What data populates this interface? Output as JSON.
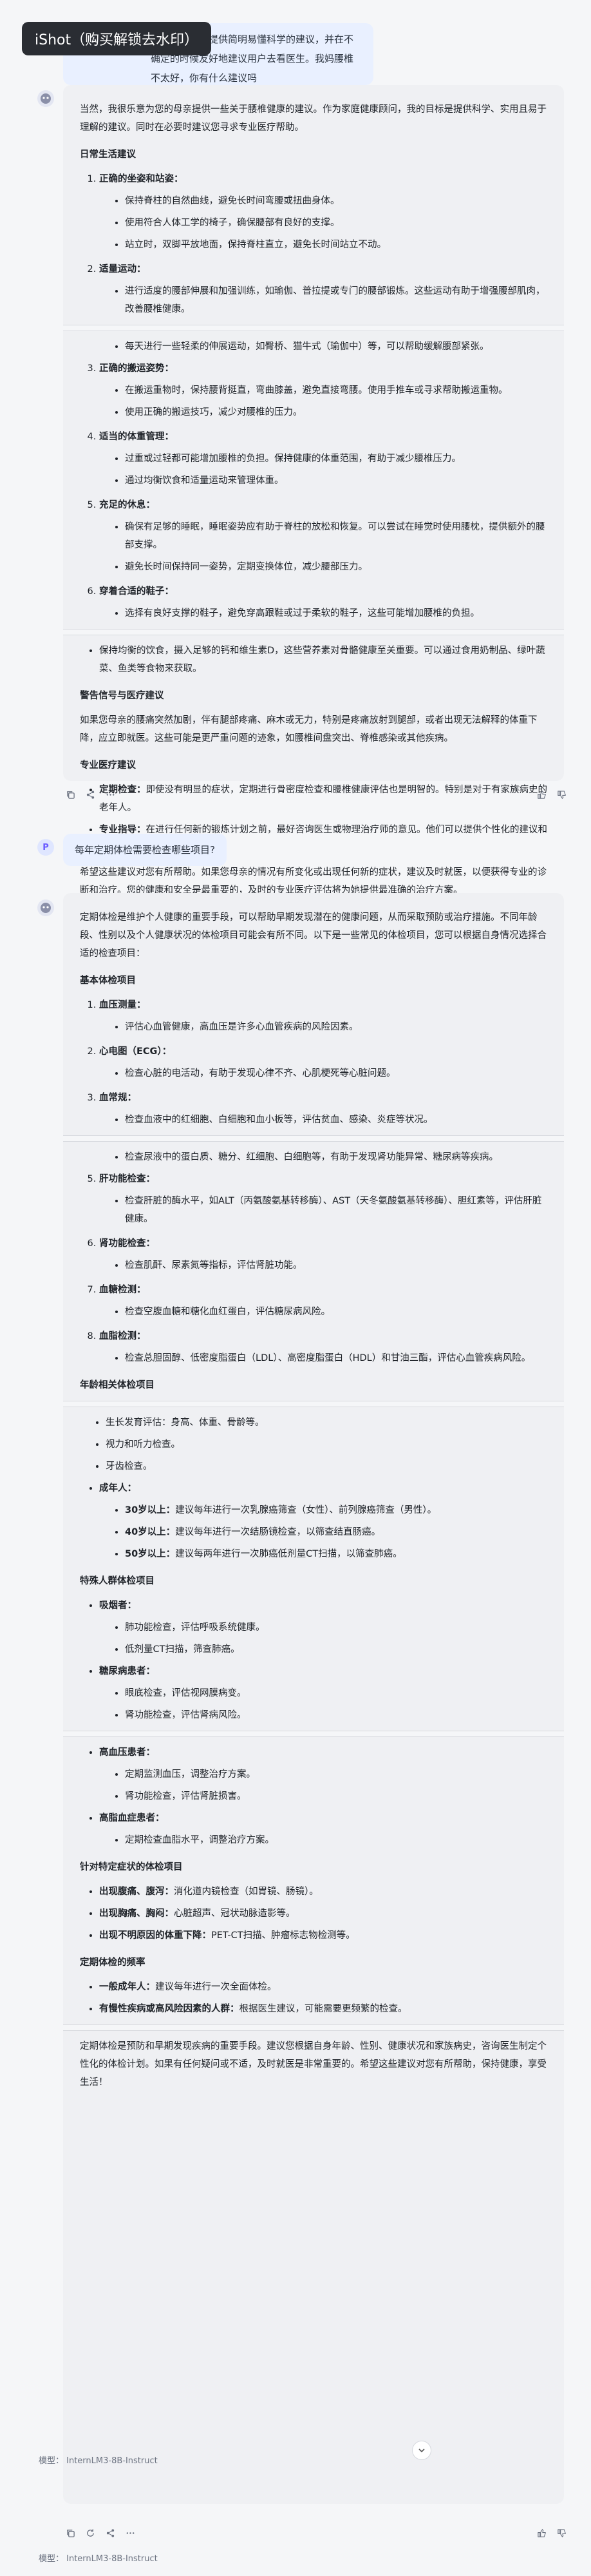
{
  "watermark": "iShot（购买解锁去水印）",
  "msg1": {
    "user_text": "可以为老年人提供简明易懂科学的建议，并在不确定的时候友好地建议用户去看医生。我妈腰椎不太好，你有什么建议吗",
    "intro": "当然，我很乐意为您的母亲提供一些关于腰椎健康的建议。作为家庭健康顾问，我的目标是提供科学、实用且易于理解的建议。同时在必要时建议您寻求专业医疗帮助。",
    "daily_title": "日常生活建议",
    "items": [
      {
        "title": "正确的坐姿和站姿：",
        "subs": [
          "保持脊柱的自然曲线，避免长时间弯腰或扭曲身体。",
          "使用符合人体工学的椅子，确保腰部有良好的支撑。",
          "站立时，双脚平放地面，保持脊柱直立，避免长时间站立不动。"
        ]
      },
      {
        "title": "适量运动：",
        "subs": [
          "进行适度的腰部伸展和加强训练，如瑜伽、普拉提或专门的腰部锻炼。这些运动有助于增强腰部肌肉，改善腰椎健康。"
        ]
      }
    ],
    "items_b_sub0": "每天进行一些轻柔的伸展运动，如臀桥、猫牛式（瑜伽中）等，可以帮助缓解腰部紧张。",
    "items2": [
      {
        "title": "正确的搬运姿势：",
        "subs": [
          "在搬运重物时，保持腰背挺直，弯曲膝盖，避免直接弯腰。使用手推车或寻求帮助搬运重物。",
          "使用正确的搬运技巧，减少对腰椎的压力。"
        ]
      },
      {
        "title": "适当的体重管理：",
        "subs": [
          "过重或过轻都可能增加腰椎的负担。保持健康的体重范围，有助于减少腰椎压力。",
          "通过均衡饮食和适量运动来管理体重。"
        ]
      },
      {
        "title": "充足的休息：",
        "subs": [
          "确保有足够的睡眠，睡眠姿势应有助于脊柱的放松和恢复。可以尝试在睡觉时使用腰枕，提供额外的腰部支撑。",
          "避免长时间保持同一姿势，定期变换体位，减少腰部压力。"
        ]
      },
      {
        "title": "穿着合适的鞋子：",
        "subs": [
          "选择有良好支撑的鞋子，避免穿高跟鞋或过于柔软的鞋子，这些可能增加腰椎的负担。"
        ]
      }
    ],
    "diet": "保持均衡的饮食，摄入足够的钙和维生素D，这些营养素对骨骼健康至关重要。可以通过食用奶制品、绿叶蔬菜、鱼类等食物来获取。",
    "warn_title": "警告信号与医疗建议",
    "warn_text": "如果您母亲的腰痛突然加剧，伴有腿部疼痛、麻木或无力，特别是疼痛放射到腿部，或者出现无法解释的体重下降，应立即就医。这些可能是更严重问题的迹象，如腰椎间盘突出、脊椎感染或其他疾病。",
    "pro_title": "专业医疗建议",
    "pro": [
      {
        "bold": "定期检查：",
        "text": "即使没有明显的症状，定期进行骨密度检查和腰椎健康评估也是明智的。特别是对于有家族病史的老年人。"
      },
      {
        "bold": "专业指导：",
        "text": "在进行任何新的锻炼计划之前，最好咨询医生或物理治疗师的意见。他们可以提供个性化的建议和指导。"
      }
    ],
    "closing": "希望这些建议对您有所帮助。如果您母亲的情况有所变化或出现任何新的症状，建议及时就医，以便获得专业的诊断和治疗。您的健康和安全是最重要的，及时的专业医疗评估将为她提供最准确的治疗方案。"
  },
  "msg2": {
    "avatar_letter": "P",
    "user_text": "每年定期体检需要检查哪些项目?",
    "intro": "定期体检是维护个人健康的重要手段，可以帮助早期发现潜在的健康问题，从而采取预防或治疗措施。不同年龄段、性别以及个人健康状况的体检项目可能会有所不同。以下是一些常见的体检项目，您可以根据自身情况选择合适的检查项目：",
    "basic_title": "基本体检项目",
    "basic": [
      {
        "title": "血压测量：",
        "subs": [
          "评估心血管健康，高血压是许多心血管疾病的风险因素。"
        ]
      },
      {
        "title": "心电图（ECG）：",
        "subs": [
          "检查心脏的电活动，有助于发现心律不齐、心肌梗死等心脏问题。"
        ]
      },
      {
        "title": "血常规：",
        "subs": [
          "检查血液中的红细胞、白细胞和血小板等，评估贫血、感染、炎症等状况。"
        ]
      }
    ],
    "basic_urine_sub": "检查尿液中的蛋白质、糖分、红细胞、白细胞等，有助于发现肾功能异常、糖尿病等疾病。",
    "basic2": [
      {
        "title": "肝功能检查：",
        "subs": [
          "检查肝脏的酶水平，如ALT（丙氨酸氨基转移酶）、AST（天冬氨酸氨基转移酶）、胆红素等，评估肝脏健康。"
        ]
      },
      {
        "title": "肾功能检查：",
        "subs": [
          "检查肌酐、尿素氮等指标，评估肾脏功能。"
        ]
      },
      {
        "title": "血糖检测：",
        "subs": [
          "检查空腹血糖和糖化血红蛋白，评估糖尿病风险。"
        ]
      },
      {
        "title": "血脂检测：",
        "subs": [
          "检查总胆固醇、低密度脂蛋白（LDL）、高密度脂蛋白（HDL）和甘油三酯，评估心血管疾病风险。"
        ]
      }
    ],
    "age_title": "年龄相关体检项目",
    "age_subs": [
      "生长发育评估：身高、体重、骨龄等。",
      "视力和听力检查。",
      "牙齿检查。"
    ],
    "adult_label": "成年人：",
    "adult": [
      {
        "bold": "30岁以上：",
        "text": "建议每年进行一次乳腺癌筛查（女性）、前列腺癌筛查（男性）。"
      },
      {
        "bold": "40岁以上：",
        "text": "建议每年进行一次结肠镜检查，以筛查结直肠癌。"
      },
      {
        "bold": "50岁以上：",
        "text": "建议每两年进行一次肺癌低剂量CT扫描，以筛查肺癌。"
      }
    ],
    "special_title": "特殊人群体检项目",
    "smoker_label": "吸烟者：",
    "smoker_subs": [
      "肺功能检查，评估呼吸系统健康。",
      "低剂量CT扫描，筛查肺癌。"
    ],
    "diabetic_label": "糖尿病患者：",
    "diabetic_subs": [
      "眼底检查，评估视网膜病变。",
      "肾功能检查，评估肾病风险。"
    ],
    "hyper_label": "高血压患者：",
    "hyper_subs": [
      "定期监测血压，调整治疗方案。",
      "肾功能检查，评估肾脏损害。"
    ],
    "lipid_label": "高脂血症患者：",
    "lipid_subs": [
      "定期检查血脂水平，调整治疗方案。"
    ],
    "symptom_title": "针对特定症状的体检项目",
    "symptoms": [
      {
        "bold": "出现腹痛、腹泻：",
        "text": "消化道内镜检查（如胃镜、肠镜）。"
      },
      {
        "bold": "出现胸痛、胸闷：",
        "text": "心脏超声、冠状动脉造影等。"
      },
      {
        "bold": "出现不明原因的体重下降：",
        "text": "PET-CT扫描、肿瘤标志物检测等。"
      }
    ],
    "freq_title": "定期体检的频率",
    "freq": [
      {
        "bold": "一般成年人：",
        "text": "建议每年进行一次全面体检。"
      },
      {
        "bold": "有慢性疾病或高风险因素的人群：",
        "text": "根据医生建议，可能需要更频繁的检查。"
      }
    ],
    "closing": "定期体检是预防和早期发现疾病的重要手段。建议您根据自身年龄、性别、健康状况和家族病史，咨询医生制定个性化的体检计划。如果有任何疑问或不适，及时就医是非常重要的。希望这些建议对您有所帮助，保持健康，享受生活！"
  },
  "model_label_1": "模型： InternLM3-8B-Instruct",
  "model_label_2": "模型： InternLM3-8B-Instruct"
}
